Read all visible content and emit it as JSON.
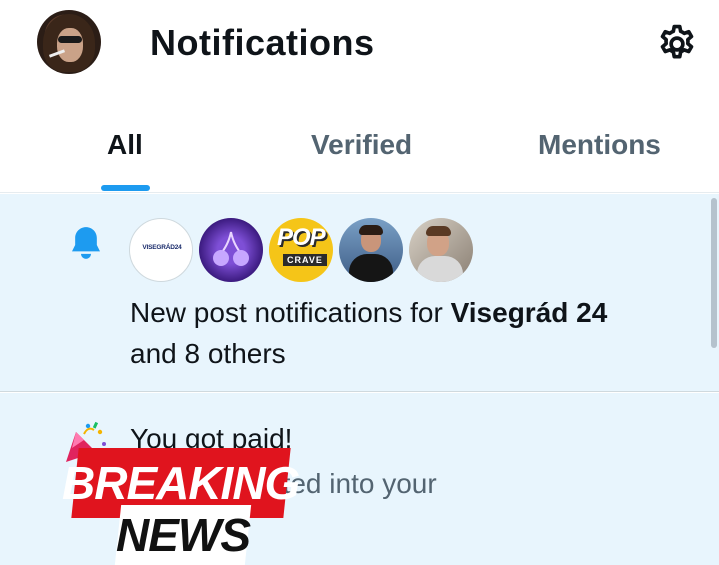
{
  "header": {
    "title": "Notifications",
    "avatar_icon": "user-avatar",
    "settings_icon": "gear-icon"
  },
  "tabs": [
    {
      "label": "All",
      "active": true
    },
    {
      "label": "Verified",
      "active": false
    },
    {
      "label": "Mentions",
      "active": false
    }
  ],
  "notifications": [
    {
      "icon": "bell-icon",
      "avatars": [
        "Visegrád 24",
        "cherry-avatar",
        "Pop Crave",
        "man-avatar-1",
        "man-avatar-2"
      ],
      "visegrad_logo": "VISEGRÁD24",
      "pop_logo_top": "POP",
      "pop_logo_bottom": "CRAVE",
      "text_prefix": "New post notifications for ",
      "text_bold": "Visegrád 24",
      "text_suffix": "and 8 others"
    },
    {
      "icon": "party-popper-icon",
      "title": "You got paid!",
      "body": "been deposited into your"
    }
  ],
  "overlay": {
    "breaking": "BREAKING",
    "news": "NEWS"
  },
  "colors": {
    "accent": "#1d9bf0",
    "highlight_bg": "#e8f5fd",
    "breaking_red": "#e0141e"
  }
}
